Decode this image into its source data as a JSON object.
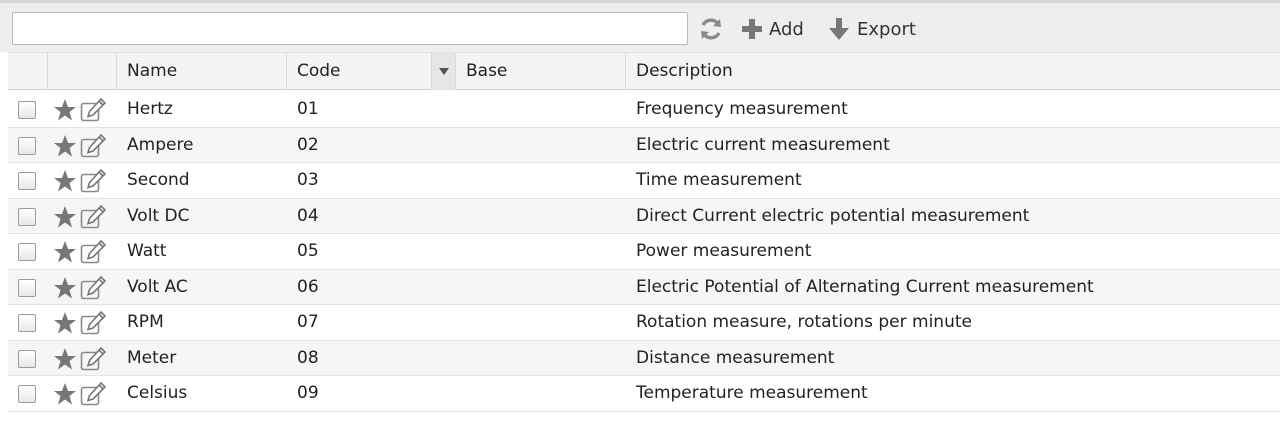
{
  "toolbar": {
    "search_value": "",
    "search_placeholder": "",
    "add_label": "Add",
    "export_label": "Export"
  },
  "table": {
    "columns": {
      "name": "Name",
      "code": "Code",
      "base": "Base",
      "description": "Description"
    },
    "rows": [
      {
        "name": "Hertz",
        "code": "01",
        "base": "",
        "description": "Frequency measurement"
      },
      {
        "name": "Ampere",
        "code": "02",
        "base": "",
        "description": "Electric current measurement"
      },
      {
        "name": "Second",
        "code": "03",
        "base": "",
        "description": "Time measurement"
      },
      {
        "name": "Volt DC",
        "code": "04",
        "base": "",
        "description": "Direct Current electric potential measurement"
      },
      {
        "name": "Watt",
        "code": "05",
        "base": "",
        "description": "Power measurement"
      },
      {
        "name": "Volt AC",
        "code": "06",
        "base": "",
        "description": "Electric Potential of Alternating Current measurement"
      },
      {
        "name": "RPM",
        "code": "07",
        "base": "",
        "description": "Rotation measure, rotations per minute"
      },
      {
        "name": "Meter",
        "code": "08",
        "base": "",
        "description": "Distance measurement"
      },
      {
        "name": "Celsius",
        "code": "09",
        "base": "",
        "description": "Temperature measurement"
      }
    ]
  },
  "colors": {
    "toolbar_bg": "#eeeeee",
    "icon_gray": "#777777",
    "header_bg": "#f4f4f4",
    "row_alt_bg": "#f6f6f6"
  },
  "icons": {
    "refresh": "refresh-icon",
    "add": "plus-icon",
    "export": "arrow-down-icon",
    "sort": "triangle-down-icon",
    "favorite": "star-icon",
    "edit": "edit-pencil-icon",
    "select": "checkbox"
  }
}
